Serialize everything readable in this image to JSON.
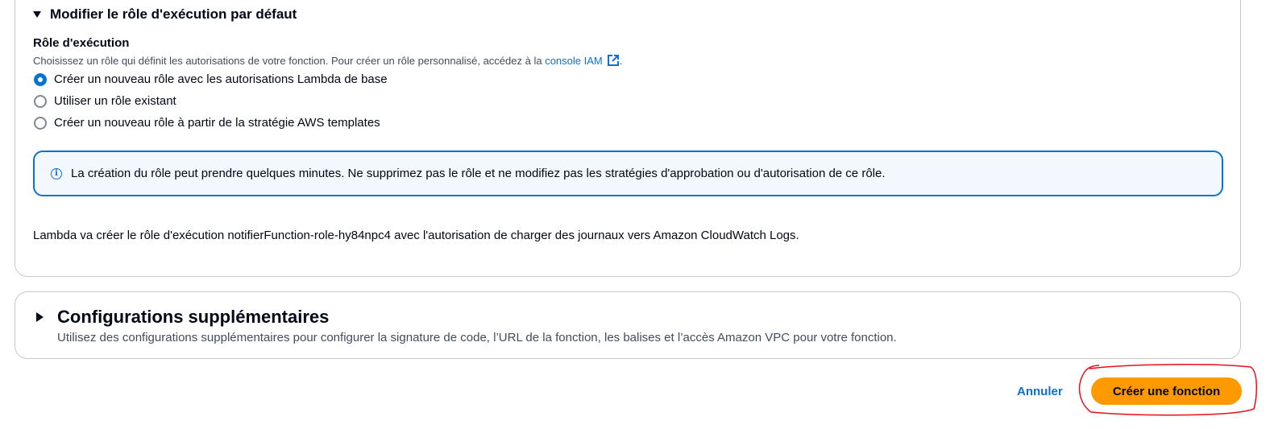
{
  "role_section": {
    "title": "Modifier le rôle d'exécution par défaut",
    "field_label": "Rôle d'exécution",
    "description_prefix": "Choisissez un rôle qui définit les autorisations de votre fonction. Pour créer un rôle personnalisé, accédez à la ",
    "description_link": "console IAM",
    "description_suffix": ".",
    "options": [
      {
        "label": "Créer un nouveau rôle avec les autorisations Lambda de base",
        "selected": true
      },
      {
        "label": "Utiliser un rôle existant",
        "selected": false
      },
      {
        "label": "Créer un nouveau rôle à partir de la stratégie AWS templates",
        "selected": false
      }
    ],
    "info_alert": "La création du rôle peut prendre quelques minutes. Ne supprimez pas le rôle et ne modifiez pas les stratégies d'approbation ou d'autorisation de ce rôle.",
    "summary": "Lambda va créer le rôle d'exécution notifierFunction-role-hy84npc4 avec l'autorisation de charger des journaux vers Amazon CloudWatch Logs."
  },
  "config_section": {
    "title": "Configurations supplémentaires",
    "description": "Utilisez des configurations supplémentaires pour configurer la signature de code, l’URL de la fonction, les balises et l’accès Amazon VPC pour votre fonction."
  },
  "actions": {
    "cancel_label": "Annuler",
    "create_label": "Créer une fonction"
  },
  "icons": {
    "expanded": "caret-down-icon",
    "collapsed": "caret-right-icon",
    "external": "external-link-icon",
    "info": "info-icon"
  },
  "colors": {
    "accent": "#0972d3",
    "primary_button": "#ff9900",
    "annotation": "#e8101b"
  }
}
